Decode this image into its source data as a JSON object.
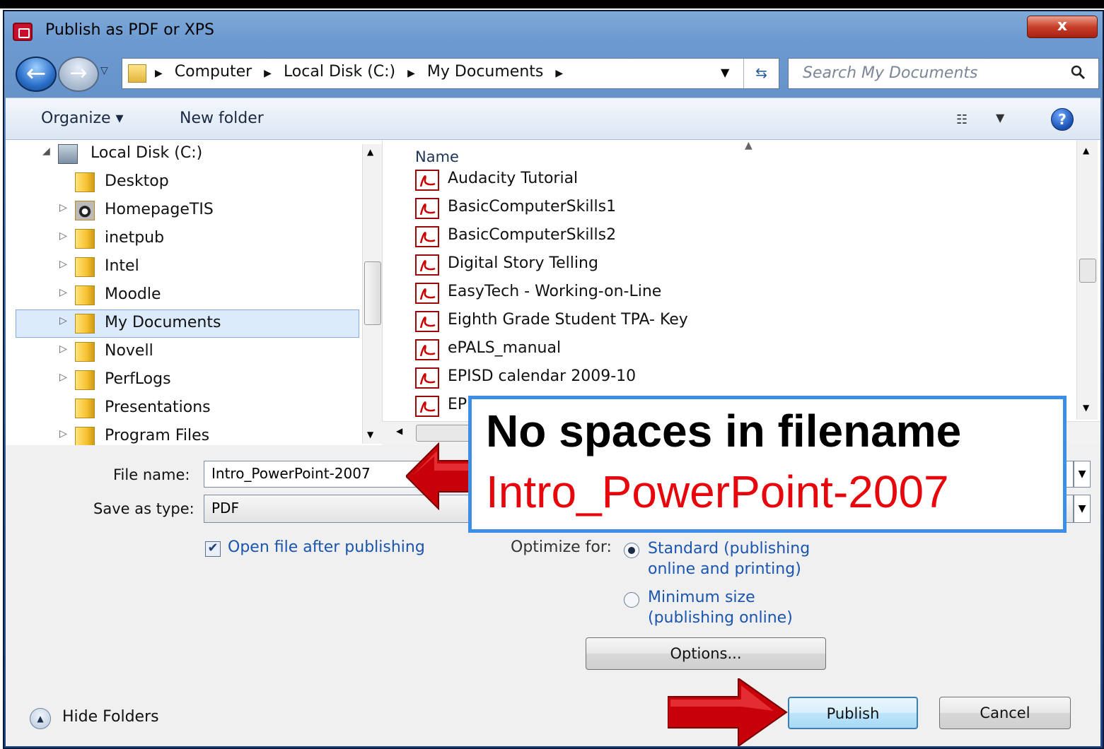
{
  "window": {
    "title": "Publish as PDF or XPS",
    "close_label": "x"
  },
  "address": {
    "crumbs": [
      "Computer",
      "Local Disk (C:)",
      "My Documents"
    ],
    "search_placeholder": "Search My Documents"
  },
  "toolbar": {
    "organize_label": "Organize ▾",
    "new_folder_label": "New folder"
  },
  "nav": {
    "items": [
      {
        "label": "Local Disk (C:)",
        "expander": "◢",
        "icon": "drive-icon"
      },
      {
        "label": "Desktop",
        "expander": "",
        "icon": "folder-icon"
      },
      {
        "label": "HomepageTIS",
        "expander": "▷",
        "icon": "camera-folder-icon"
      },
      {
        "label": "inetpub",
        "expander": "▷",
        "icon": "folder-icon"
      },
      {
        "label": "Intel",
        "expander": "▷",
        "icon": "folder-icon"
      },
      {
        "label": "Moodle",
        "expander": "▷",
        "icon": "folder-icon"
      },
      {
        "label": "My Documents",
        "expander": "▷",
        "icon": "folder-icon",
        "selected": true
      },
      {
        "label": "Novell",
        "expander": "▷",
        "icon": "folder-icon"
      },
      {
        "label": "PerfLogs",
        "expander": "▷",
        "icon": "folder-icon"
      },
      {
        "label": "Presentations",
        "expander": "",
        "icon": "folder-icon"
      },
      {
        "label": "Program Files",
        "expander": "▷",
        "icon": "folder-icon"
      }
    ]
  },
  "files": {
    "column_name": "Name",
    "items": [
      "Audacity Tutorial",
      "BasicComputerSkills1",
      "BasicComputerSkills2",
      "Digital Story Telling",
      "EasyTech - Working-on-Line",
      "Eighth Grade Student TPA- Key",
      "ePALS_manual",
      "EPISD calendar 2009-10",
      "EP"
    ]
  },
  "form": {
    "file_name_label": "File name:",
    "file_name_value": "Intro_PowerPoint-2007",
    "save_type_label": "Save as type:",
    "save_type_value": "PDF",
    "open_after_label": "Open file after publishing",
    "open_after_checked": true,
    "optimize_label": "Optimize for:",
    "optimize_options": [
      {
        "line1": "Standard (publishing",
        "line2": "online and printing)",
        "selected": true
      },
      {
        "line1": "Minimum size",
        "line2": "(publishing online)",
        "selected": false
      }
    ],
    "options_button": "Options...",
    "publish_button": "Publish",
    "cancel_button": "Cancel",
    "hide_folders_label": "Hide Folders"
  },
  "callout": {
    "line1": "No spaces in filename",
    "line2": "Intro_PowerPoint-2007"
  },
  "colors": {
    "callout_border": "#3d8ee6",
    "callout_red_text": "#e6060c",
    "arrow_red": "#c8000a"
  }
}
